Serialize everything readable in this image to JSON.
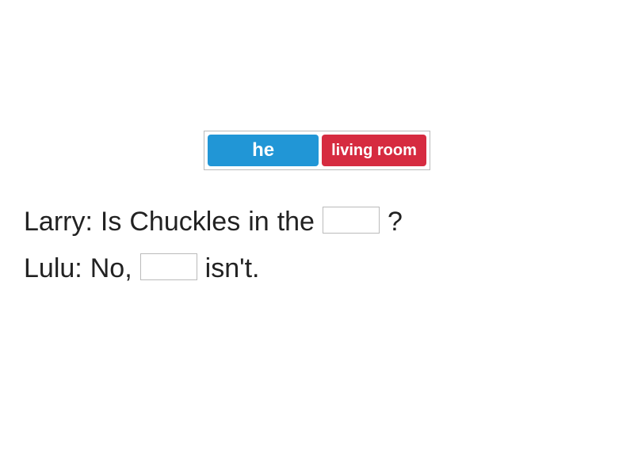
{
  "wordBank": {
    "tiles": [
      {
        "label": "he",
        "color": "blue"
      },
      {
        "label": "living room",
        "color": "red"
      }
    ]
  },
  "dialogue": {
    "line1": {
      "parts": [
        "Larry:",
        "Is",
        "Chuckles",
        "in",
        "the"
      ],
      "tail": "?"
    },
    "line2": {
      "parts": [
        "Lulu:",
        "No,"
      ],
      "tail": "isn't."
    }
  }
}
